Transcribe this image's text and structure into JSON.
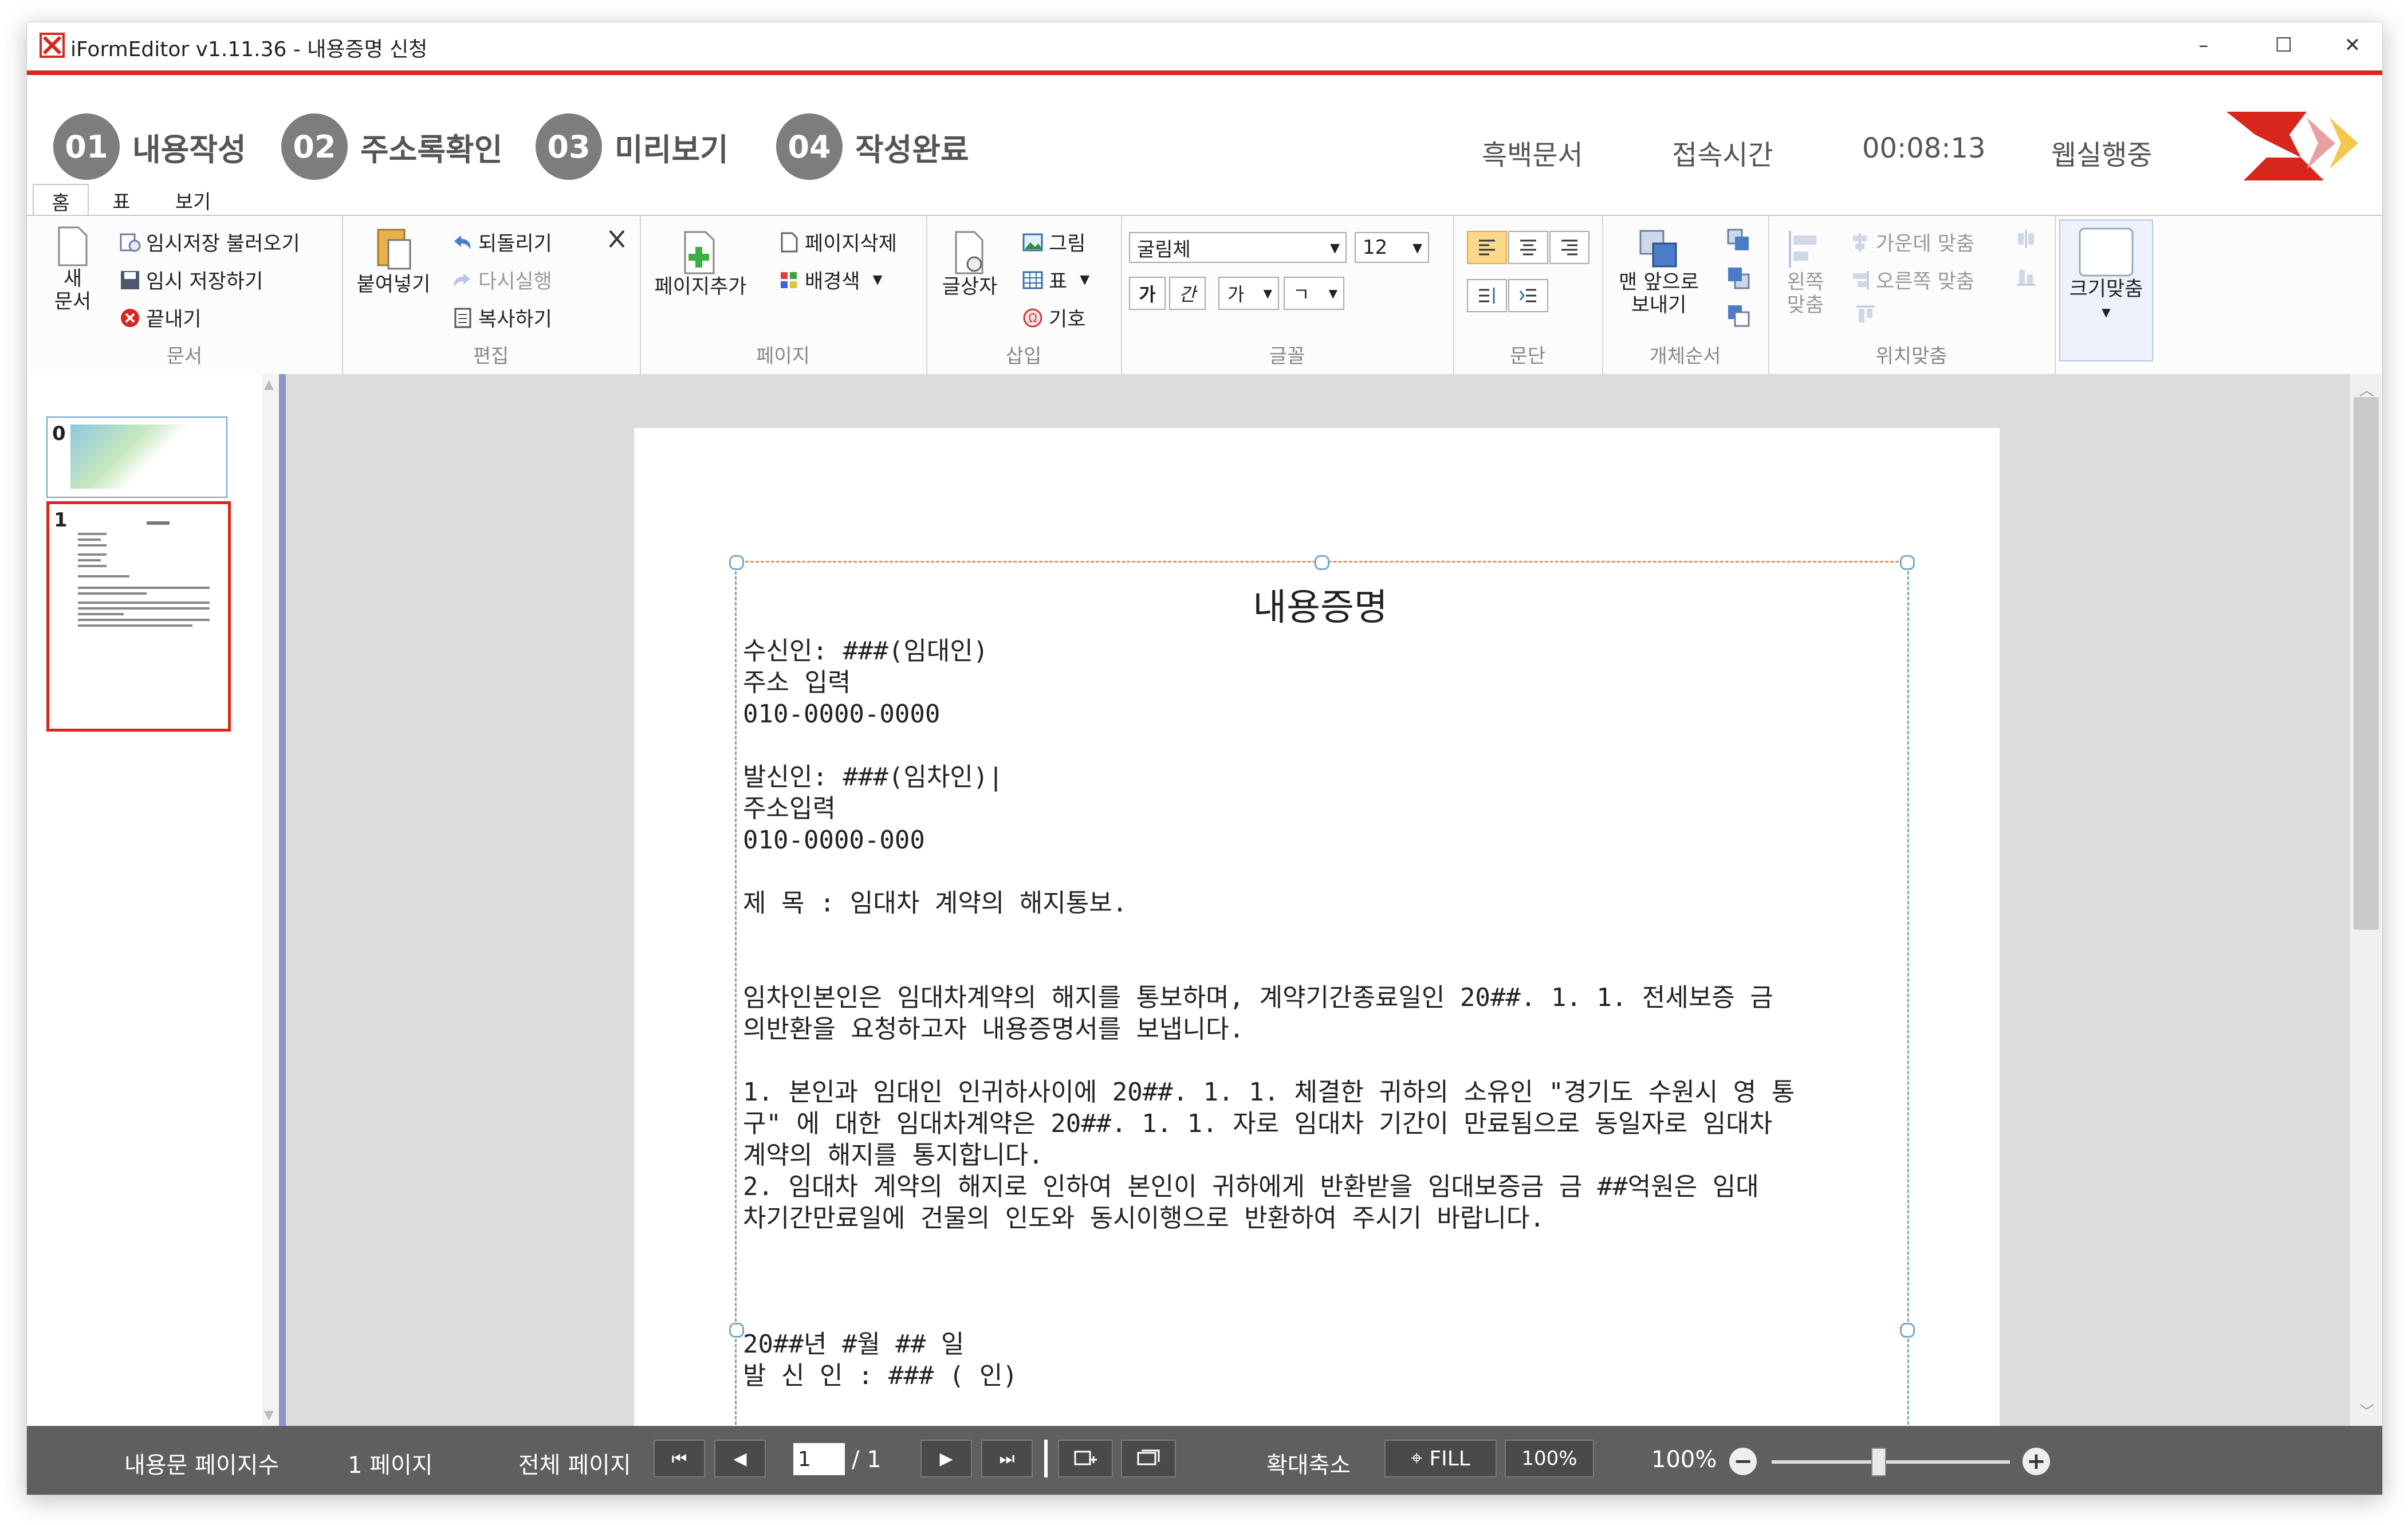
{
  "window": {
    "title": "iFormEditor v1.11.36 - 내용증명 신청",
    "minimize": "–",
    "maximize": "☐",
    "close": "✕"
  },
  "steps": [
    {
      "num": "01",
      "label": "내용작성"
    },
    {
      "num": "02",
      "label": "주소록확인"
    },
    {
      "num": "03",
      "label": "미리보기"
    },
    {
      "num": "04",
      "label": "작성완료"
    }
  ],
  "status": {
    "mono": "흑백문서",
    "access_label": "접속시간",
    "access_time": "00:08:13",
    "webroom": "웹실행중"
  },
  "tabs": [
    "홈",
    "표",
    "보기"
  ],
  "ribbon": {
    "doc_group": {
      "new": "새\n문서",
      "load_temp": "임시저장 불러오기",
      "save_temp": "임시 저장하기",
      "exit": "끝내기",
      "label": "문서"
    },
    "edit_group": {
      "paste": "붙여넣기",
      "undo": "되돌리기",
      "redo": "다시실행",
      "copy": "복사하기",
      "label": "편집"
    },
    "page_group": {
      "add": "페이지추가",
      "delete": "페이지삭제",
      "bg": "배경색",
      "label": "페이지"
    },
    "insert_group": {
      "textbox": "글상자",
      "picture": "그림",
      "table": "표",
      "symbol": "기호",
      "label": "삽입"
    },
    "font_group": {
      "font": "굴림체",
      "size": "12",
      "bold": "가",
      "italic": "간",
      "color": "가",
      "bg": "ㄱ",
      "label": "글꼴"
    },
    "para_group": {
      "label": "문단"
    },
    "order_group": {
      "front": "맨 앞으로\n보내기",
      "label": "개체순서"
    },
    "pos_group": {
      "left": "왼쪽\n맞춤",
      "center": "가운데 맞춤",
      "right": "오른쪽 맞춤",
      "label": "위치맞춤"
    },
    "fit_group": {
      "fit": "크기맞춤"
    }
  },
  "thumbnails": [
    {
      "num": "0"
    },
    {
      "num": "1"
    }
  ],
  "document": {
    "title": "내용증명",
    "lines": [
      "수신인: ###(임대인)",
      "주소 입력",
      "010-0000-0000",
      "",
      "발신인: ###(임차인)|",
      "주소입력",
      "010-0000-000",
      "",
      "제 목 : 임대차 계약의 해지통보.",
      "",
      "",
      "임차인본인은 임대차계약의 해지를 통보하며, 계약기간종료일인 20##. 1. 1. 전세보증 금",
      "의반환을 요청하고자 내용증명서를 보냅니다.",
      "",
      "1. 본인과 임대인 인귀하사이에 20##. 1. 1. 체결한 귀하의 소유인 \"경기도 수원시 영 통",
      "구\" 에 대한 임대차계약은 20##. 1. 1. 자로 임대차 기간이 만료됨으로 동일자로 임대차",
      "계약의 해지를 통지합니다.",
      "2. 임대차 계약의 해지로 인하여 본인이 귀하에게 반환받을 임대보증금 금 ##억원은 임대",
      "차기간만료일에 건물의 인도와 동시이행으로 반환하여 주시기 바랍니다.",
      "",
      "",
      "",
      "20##년 #월 ## 일",
      "발 신 인 : ### ( 인)"
    ]
  },
  "bottom": {
    "page_count_label": "내용문 페이지수",
    "page_count": "1 페이지",
    "total_label": "전체 페이지",
    "current_page": "1",
    "total_pages": "/ 1",
    "zoom_label": "확대축소",
    "fill": "FILL",
    "hundred": "100%",
    "zoom_value": "100%",
    "zoom_level_fraction": 0.45
  }
}
